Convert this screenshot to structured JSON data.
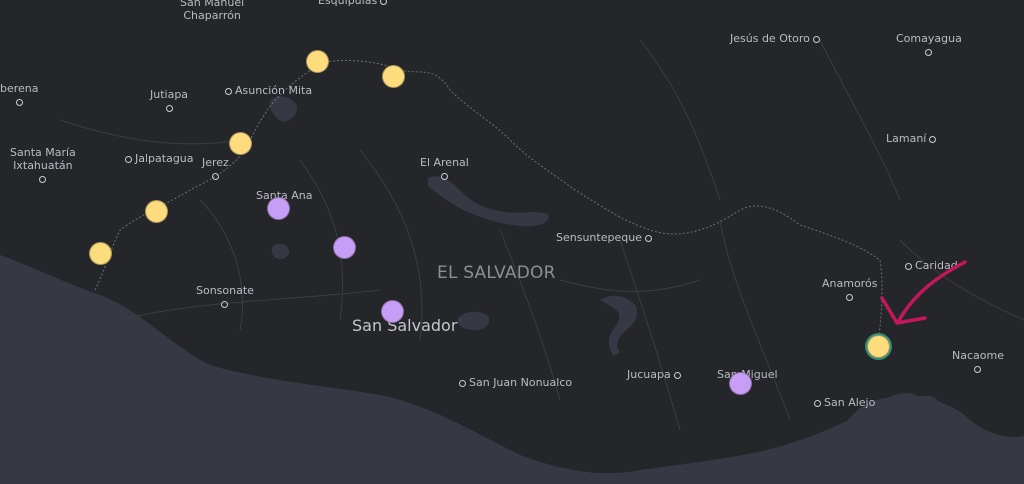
{
  "map": {
    "country_label": "EL SALVADOR",
    "capital_label": "San Salvador",
    "places": [
      {
        "id": "san-manuel-chaparron",
        "text": "San Manuel\nChaparrón",
        "dot": false
      },
      {
        "id": "esquipulas",
        "text": "Esquipulas",
        "dot": true
      },
      {
        "id": "jesus-de-otoro",
        "text": "Jesús de Otoro",
        "dot": true
      },
      {
        "id": "comayagua",
        "text": "Comayagua",
        "dot": true
      },
      {
        "id": "barberena",
        "text": "berena",
        "dot": true
      },
      {
        "id": "jutiapa",
        "text": "Jutiapa",
        "dot": true
      },
      {
        "id": "asuncion-mita",
        "text": "Asunción Mita",
        "dot": true
      },
      {
        "id": "lamani",
        "text": "Lamaní",
        "dot": true
      },
      {
        "id": "santa-maria-ixtahuatan",
        "text": "Santa María\nIxtahuatán",
        "dot": true
      },
      {
        "id": "jalpatagua",
        "text": "Jalpatagua",
        "dot": true
      },
      {
        "id": "jerez",
        "text": "Jerez",
        "dot": true
      },
      {
        "id": "el-arenal",
        "text": "El Arenal",
        "dot": true
      },
      {
        "id": "santa-ana",
        "text": "Santa Ana",
        "dot": false
      },
      {
        "id": "sensuntepeque",
        "text": "Sensuntepeque",
        "dot": true
      },
      {
        "id": "caridad",
        "text": "Caridad",
        "dot": true
      },
      {
        "id": "anamoros",
        "text": "Anamorós",
        "dot": true
      },
      {
        "id": "sonsonate",
        "text": "Sonsonate",
        "dot": true
      },
      {
        "id": "nacaome",
        "text": "Nacaome",
        "dot": true
      },
      {
        "id": "jucuapa",
        "text": "Jucuapa",
        "dot": true
      },
      {
        "id": "san-miguel",
        "text": "San Miguel",
        "dot": false
      },
      {
        "id": "san-juan-nonualco",
        "text": "San Juan Nonualco",
        "dot": true
      },
      {
        "id": "san-alejo",
        "text": "San Alejo",
        "dot": true
      }
    ],
    "markers": [
      {
        "id": "marker-1",
        "category": "yellow",
        "selected": false
      },
      {
        "id": "marker-2",
        "category": "yellow",
        "selected": false
      },
      {
        "id": "marker-3",
        "category": "yellow",
        "selected": false
      },
      {
        "id": "marker-4",
        "category": "yellow",
        "selected": false
      },
      {
        "id": "marker-5",
        "category": "yellow",
        "selected": false
      },
      {
        "id": "marker-6",
        "category": "purple",
        "selected": false
      },
      {
        "id": "marker-7",
        "category": "purple",
        "selected": false
      },
      {
        "id": "marker-8",
        "category": "purple",
        "selected": false
      },
      {
        "id": "marker-9",
        "category": "purple",
        "selected": false
      },
      {
        "id": "marker-10",
        "category": "yellow",
        "selected": true
      }
    ],
    "colors": {
      "yellow_marker": "#fddc7e",
      "purple_marker": "#c79ef5",
      "annotation_arrow": "#c2185b",
      "ocean": "#363944",
      "land": "#242629"
    }
  }
}
